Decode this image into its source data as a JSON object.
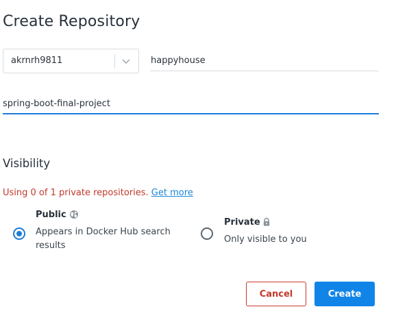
{
  "page": {
    "title": "Create Repository"
  },
  "form": {
    "namespace": {
      "value": "akrnrh9811",
      "icon": "chevron-down-icon"
    },
    "repo_name": {
      "value": "happyhouse"
    },
    "description": {
      "value": "spring-boot-final-project"
    }
  },
  "visibility": {
    "title": "Visibility",
    "usage_text": "Using 0 of 1 private repositories.",
    "get_more_link": "Get more",
    "selected": "public",
    "options": [
      {
        "id": "public",
        "label": "Public",
        "icon": "globe-icon",
        "description": "Appears in Docker Hub search results"
      },
      {
        "id": "private",
        "label": "Private",
        "icon": "lock-icon",
        "description": "Only visible to you"
      }
    ]
  },
  "actions": {
    "cancel_label": "Cancel",
    "create_label": "Create"
  },
  "colors": {
    "primary": "#1184e8",
    "danger": "#c1392b",
    "text": "#27313b"
  }
}
